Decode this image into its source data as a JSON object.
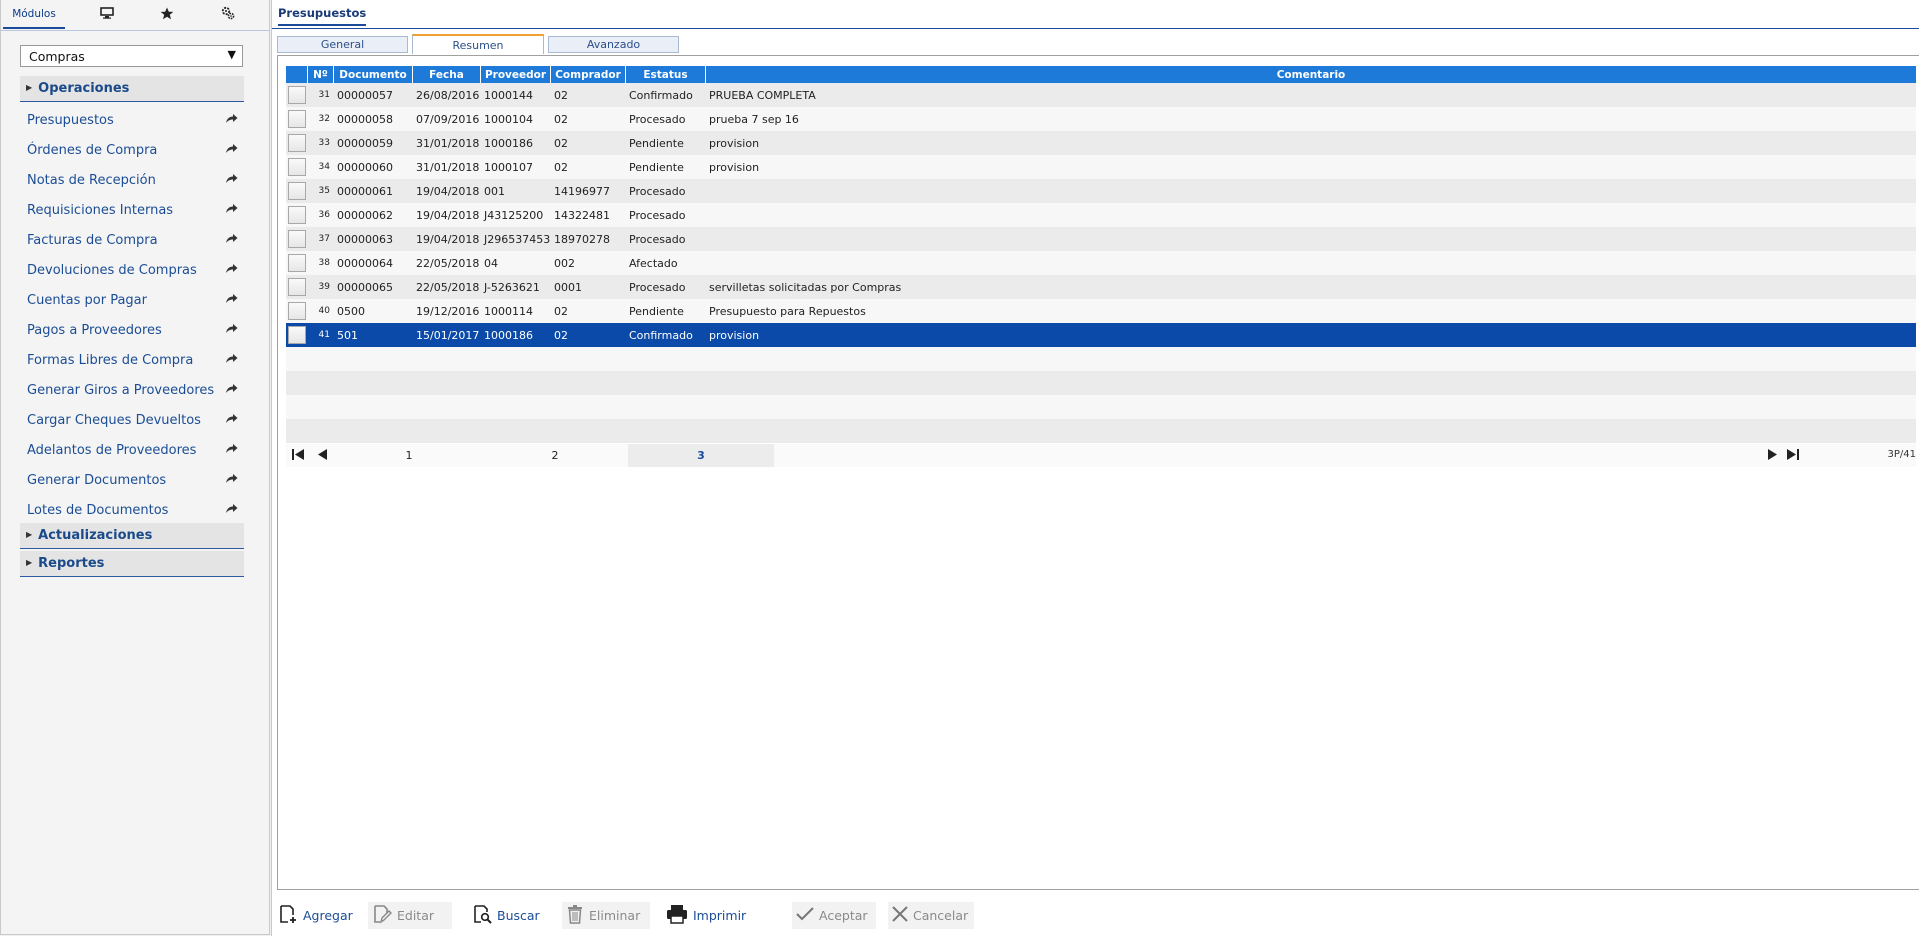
{
  "sidebar": {
    "tabs": [
      {
        "label": "Módulos",
        "icon": ""
      },
      {
        "label": "",
        "icon": "monitor-icon"
      },
      {
        "label": "",
        "icon": "star-icon"
      },
      {
        "label": "",
        "icon": "settings-icon"
      }
    ],
    "module_select": "Compras",
    "sections": {
      "operaciones": "Operaciones",
      "actualizaciones": "Actualizaciones",
      "reportes": "Reportes"
    },
    "items": [
      "Presupuestos",
      "Órdenes de Compra",
      "Notas de Recepción",
      "Requisiciones Internas",
      "Facturas de Compra",
      "Devoluciones de Compras",
      "Cuentas por Pagar",
      "Pagos a Proveedores",
      "Formas Libres de Compra",
      "Generar Giros a Proveedores",
      "Cargar Cheques Devueltos",
      "Adelantos de Proveedores",
      "Generar Documentos",
      "Lotes de Documentos"
    ]
  },
  "main": {
    "title": "Presupuestos",
    "tabs": [
      "General",
      "Resumen",
      "Avanzado"
    ],
    "active_tab": "Resumen",
    "grid": {
      "columns": [
        "Nº",
        "Documento",
        "Fecha",
        "Proveedor",
        "Comprador",
        "Estatus",
        "Comentario"
      ],
      "rows": [
        [
          "31",
          "00000057",
          "26/08/2016",
          "1000144",
          "02",
          "Confirmado",
          "PRUEBA COMPLETA"
        ],
        [
          "32",
          "00000058",
          "07/09/2016",
          "1000104",
          "02",
          "Procesado",
          "prueba 7 sep 16"
        ],
        [
          "33",
          "00000059",
          "31/01/2018",
          "1000186",
          "02",
          "Pendiente",
          "provision"
        ],
        [
          "34",
          "00000060",
          "31/01/2018",
          "1000107",
          "02",
          "Pendiente",
          "provision"
        ],
        [
          "35",
          "00000061",
          "19/04/2018",
          "001",
          "14196977",
          "Procesado",
          ""
        ],
        [
          "36",
          "00000062",
          "19/04/2018",
          "J43125200",
          "14322481",
          "Procesado",
          ""
        ],
        [
          "37",
          "00000063",
          "19/04/2018",
          "J296537453",
          "18970278",
          "Procesado",
          ""
        ],
        [
          "38",
          "00000064",
          "22/05/2018",
          "04",
          "002",
          "Afectado",
          ""
        ],
        [
          "39",
          "00000065",
          "22/05/2018",
          "J-5263621",
          "0001",
          "Procesado",
          "servilletas solicitadas por Compras"
        ],
        [
          "40",
          "0500",
          "19/12/2016",
          "1000114",
          "02",
          "Pendiente",
          "Presupuesto para Repuestos"
        ],
        [
          "41",
          "501",
          "15/01/2017",
          "1000186",
          "02",
          "Confirmado",
          "provision"
        ]
      ],
      "selected_row": 10,
      "empty_rows": 4
    },
    "pager": {
      "pages": [
        "1",
        "2",
        "3"
      ],
      "current": "3",
      "count": "3P/41"
    },
    "toolbar": [
      {
        "label": "Agregar",
        "icon": "add-document-icon",
        "enabled": true
      },
      {
        "label": "Editar",
        "icon": "edit-icon",
        "enabled": false
      },
      {
        "label": "Buscar",
        "icon": "search-document-icon",
        "enabled": true
      },
      {
        "label": "Eliminar",
        "icon": "trash-icon",
        "enabled": false
      },
      {
        "label": "Imprimir",
        "icon": "printer-icon",
        "enabled": true
      },
      {
        "label": "Aceptar",
        "icon": "check-icon",
        "enabled": false
      },
      {
        "label": "Cancelar",
        "icon": "cancel-icon",
        "enabled": false
      }
    ],
    "colors": {
      "header_blue": "#1e7ad8",
      "selected_row": "#0b4aa8",
      "link_blue": "#1b4d95"
    }
  }
}
